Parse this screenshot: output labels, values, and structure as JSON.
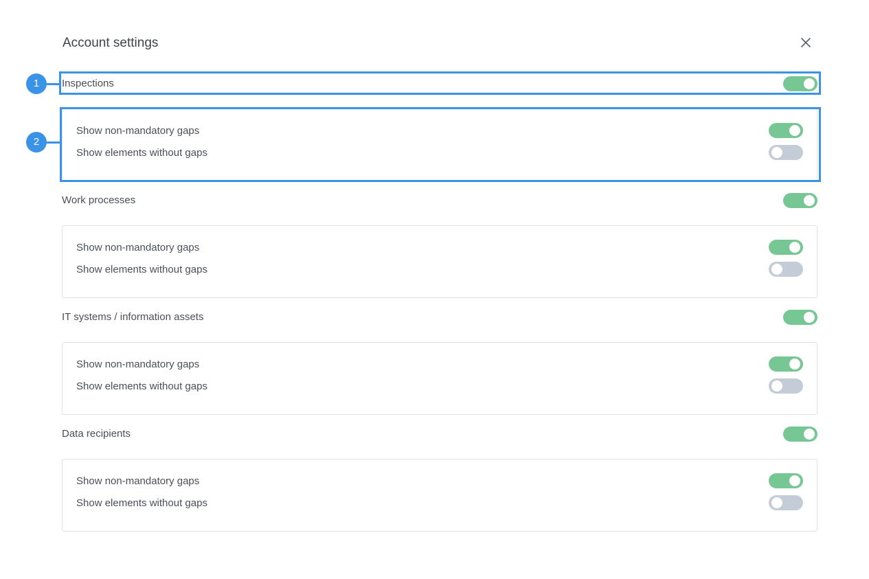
{
  "dialog": {
    "title": "Account settings",
    "close_icon": "close-icon"
  },
  "sections": [
    {
      "label": "Inspections",
      "enabled": true,
      "options": [
        {
          "label": "Show non-mandatory gaps",
          "enabled": true
        },
        {
          "label": "Show elements without gaps",
          "enabled": false
        }
      ]
    },
    {
      "label": "Work processes",
      "enabled": true,
      "options": [
        {
          "label": "Show non-mandatory gaps",
          "enabled": true
        },
        {
          "label": "Show elements without gaps",
          "enabled": false
        }
      ]
    },
    {
      "label": "IT systems / information assets",
      "enabled": true,
      "options": [
        {
          "label": "Show non-mandatory gaps",
          "enabled": true
        },
        {
          "label": "Show elements without gaps",
          "enabled": false
        }
      ]
    },
    {
      "label": "Data recipients",
      "enabled": true,
      "options": [
        {
          "label": "Show non-mandatory gaps",
          "enabled": true
        },
        {
          "label": "Show elements without gaps",
          "enabled": false
        }
      ]
    }
  ],
  "annotations": [
    {
      "number": "1"
    },
    {
      "number": "2"
    }
  ],
  "colors": {
    "toggle_on": "#77c795",
    "toggle_off": "#c4ccd8",
    "annotation": "#3b93e8"
  }
}
